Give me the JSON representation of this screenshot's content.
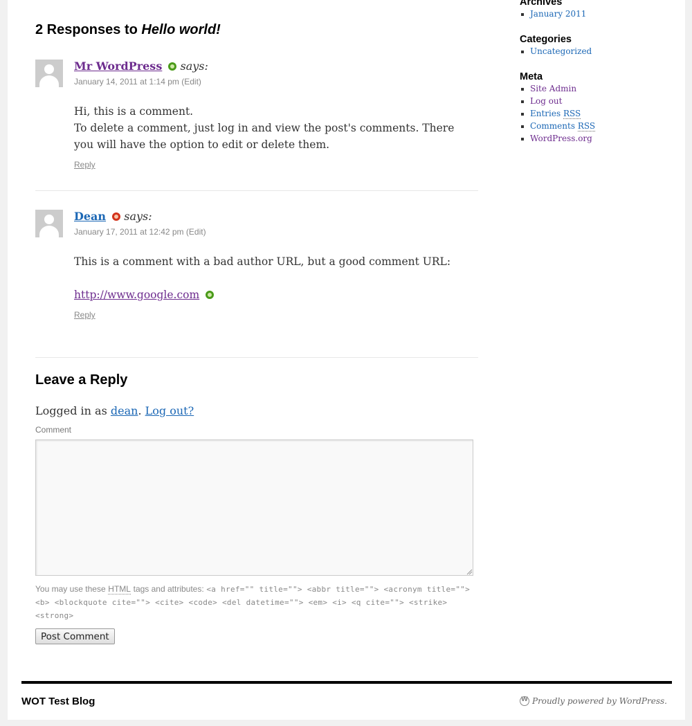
{
  "comments_section": {
    "count_prefix": "2 Responses to",
    "post_title": "Hello world!"
  },
  "comments": [
    {
      "author": "Mr WordPress",
      "author_color": "#6d2c8e",
      "wot_rating": "green",
      "says": "says:",
      "date": "January 14, 2011 at 1:14 pm",
      "edit_label": "(Edit)",
      "lines": [
        "Hi, this is a comment.",
        "To delete a comment, just log in and view the post's comments. There you will have the option to edit or delete them."
      ],
      "reply_label": "Reply"
    },
    {
      "author": "Dean",
      "author_color": "#1b67b5",
      "wot_rating": "red",
      "says": "says:",
      "date": "January 17, 2011 at 12:42 pm",
      "edit_label": "(Edit)",
      "lines": [
        "This is a comment with a bad author URL, but a good comment URL:"
      ],
      "link": "http://www.google.com",
      "link_wot_rating": "green",
      "reply_label": "Reply"
    }
  ],
  "reply_form": {
    "title": "Leave a Reply",
    "logged_in_prefix": "Logged in as",
    "username": "dean",
    "logout_label": "Log out?",
    "comment_label": "Comment",
    "comment_value": "",
    "allowed_lead": "You may use these",
    "allowed_abbr": "HTML",
    "allowed_tail": "tags and attributes:",
    "allowed_tags": "<a href=\"\" title=\"\"> <abbr title=\"\"> <acronym title=\"\"> <b> <blockquote cite=\"\"> <cite> <code> <del datetime=\"\"> <em> <i> <q cite=\"\"> <strike> <strong>",
    "submit_label": "Post Comment"
  },
  "sidebar": {
    "archives": {
      "title": "Archives",
      "items": [
        "January 2011"
      ]
    },
    "categories": {
      "title": "Categories",
      "items": [
        "Uncategorized"
      ]
    },
    "meta": {
      "title": "Meta",
      "items": [
        {
          "label": "Site Admin"
        },
        {
          "label": "Log out"
        },
        {
          "label": "Entries",
          "abbr": "RSS"
        },
        {
          "label": "Comments",
          "abbr": "RSS"
        },
        {
          "label": "WordPress.org"
        }
      ]
    }
  },
  "footer": {
    "site_name": "WOT Test Blog",
    "powered_by": "Proudly powered by WordPress."
  },
  "colors": {
    "link_visited": "#6d2c8e",
    "link": "#1b67b5",
    "wot_green": "#4a9b1a",
    "wot_red": "#d3321b"
  }
}
